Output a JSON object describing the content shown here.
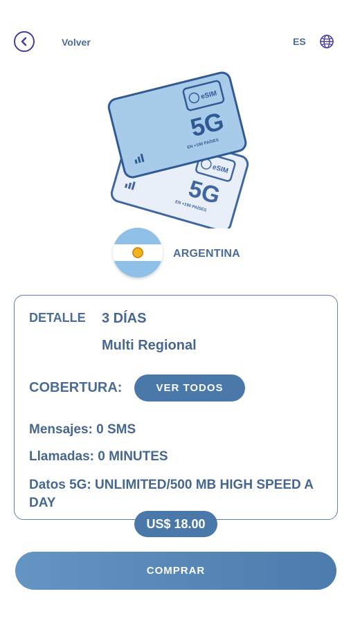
{
  "header": {
    "back_label": "Volver",
    "language": "ES"
  },
  "sim_art": {
    "badge": "eSIM",
    "network": "5G",
    "caption": "EN +190 PAÍSES"
  },
  "country": "ARGENTINA",
  "detail": {
    "label": "DETALLE",
    "days": "3 DÍAS",
    "region": "Multi Regional",
    "coverage_label": "COBERTURA:",
    "coverage_button": "VER TODOS",
    "messages": "Mensajes: 0 SMS",
    "calls": "Llamadas: 0 MINUTES",
    "data": "Datos 5G: UNLIMITED/500 MB HIGH SPEED A DAY"
  },
  "price": "US$ 18.00",
  "buy_button": "COMPRAR",
  "colors": {
    "primary": "#4a78a9",
    "text": "#4b6c96",
    "back_icon": "#4b3a9c"
  }
}
